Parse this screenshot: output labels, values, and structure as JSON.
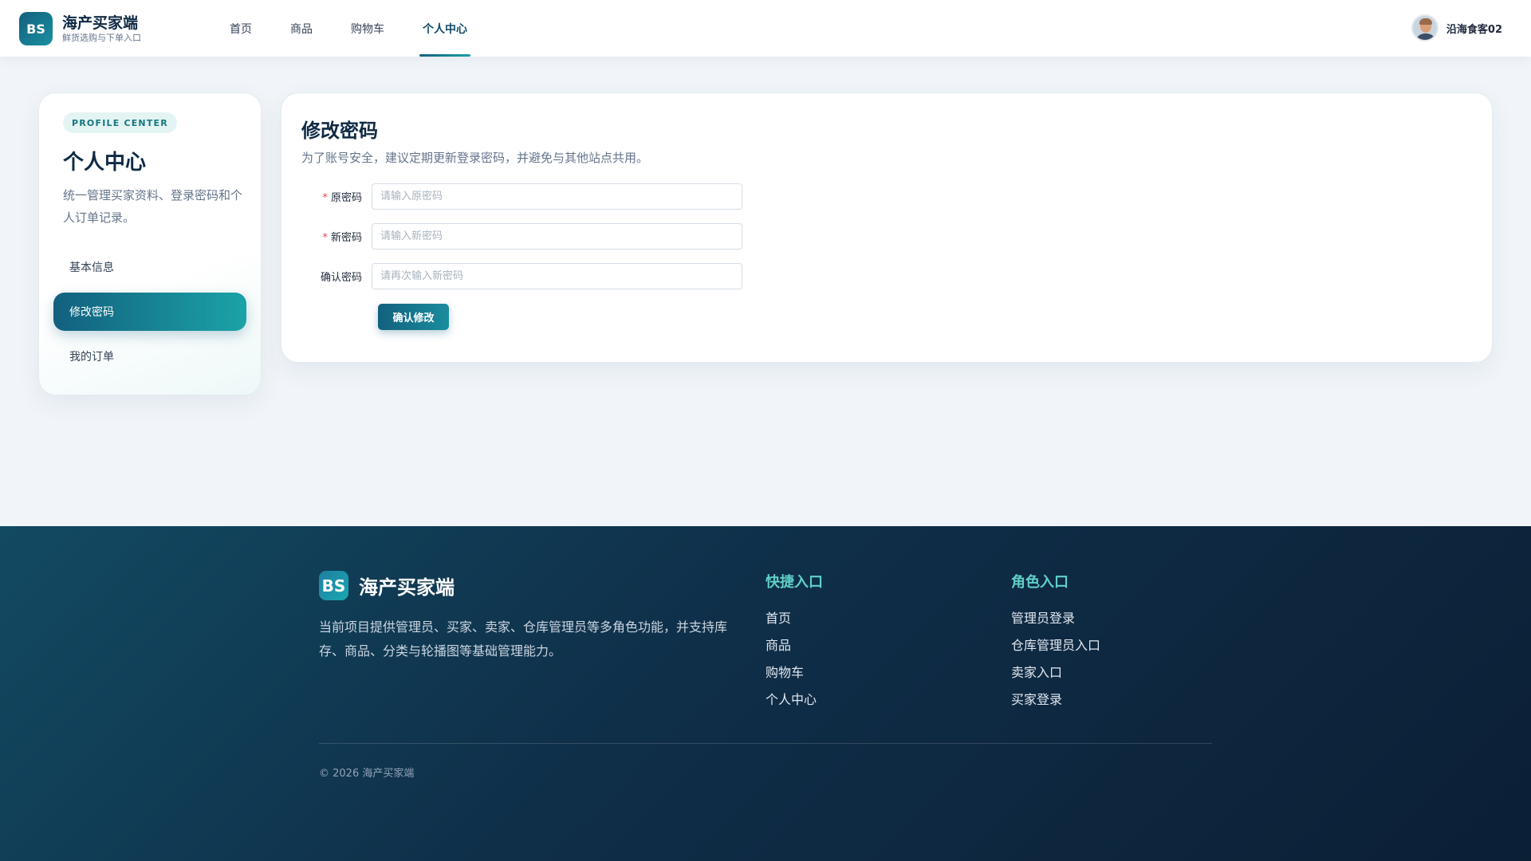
{
  "header": {
    "logo_text": "BS",
    "brand_name": "海产买家端",
    "brand_sub": "鲜货选购与下单入口",
    "nav": [
      {
        "label": "首页",
        "active": false
      },
      {
        "label": "商品",
        "active": false
      },
      {
        "label": "购物车",
        "active": false
      },
      {
        "label": "个人中心",
        "active": true
      }
    ],
    "user_name": "沿海食客02"
  },
  "sidebar": {
    "badge": "PROFILE CENTER",
    "title": "个人中心",
    "desc": "统一管理买家资料、登录密码和个人订单记录。",
    "items": [
      {
        "label": "基本信息",
        "active": false
      },
      {
        "label": "修改密码",
        "active": true
      },
      {
        "label": "我的订单",
        "active": false
      }
    ]
  },
  "main": {
    "title": "修改密码",
    "desc": "为了账号安全，建议定期更新登录密码，并避免与其他站点共用。",
    "fields": [
      {
        "label": "原密码",
        "required": true,
        "placeholder": "请输入原密码",
        "value": ""
      },
      {
        "label": "新密码",
        "required": true,
        "placeholder": "请输入新密码",
        "value": ""
      },
      {
        "label": "确认密码",
        "required": false,
        "placeholder": "请再次输入新密码",
        "value": ""
      }
    ],
    "required_mark": "*",
    "submit_label": "确认修改"
  },
  "footer": {
    "logo_text": "BS",
    "brand_name": "海产买家端",
    "desc": "当前项目提供管理员、买家、卖家、仓库管理员等多角色功能，并支持库存、商品、分类与轮播图等基础管理能力。",
    "quick": {
      "title": "快捷入口",
      "links": [
        "首页",
        "商品",
        "购物车",
        "个人中心"
      ]
    },
    "roles": {
      "title": "角色入口",
      "links": [
        "管理员登录",
        "仓库管理员入口",
        "卖家入口",
        "买家登录"
      ]
    },
    "copyright": "© 2026 海产买家端"
  },
  "colors": {
    "primary": "#12607e",
    "accent": "#1ba3a7",
    "footer_bg": "#0f2e48",
    "footer_heading": "#5fd0c8",
    "required": "#e5484d"
  }
}
